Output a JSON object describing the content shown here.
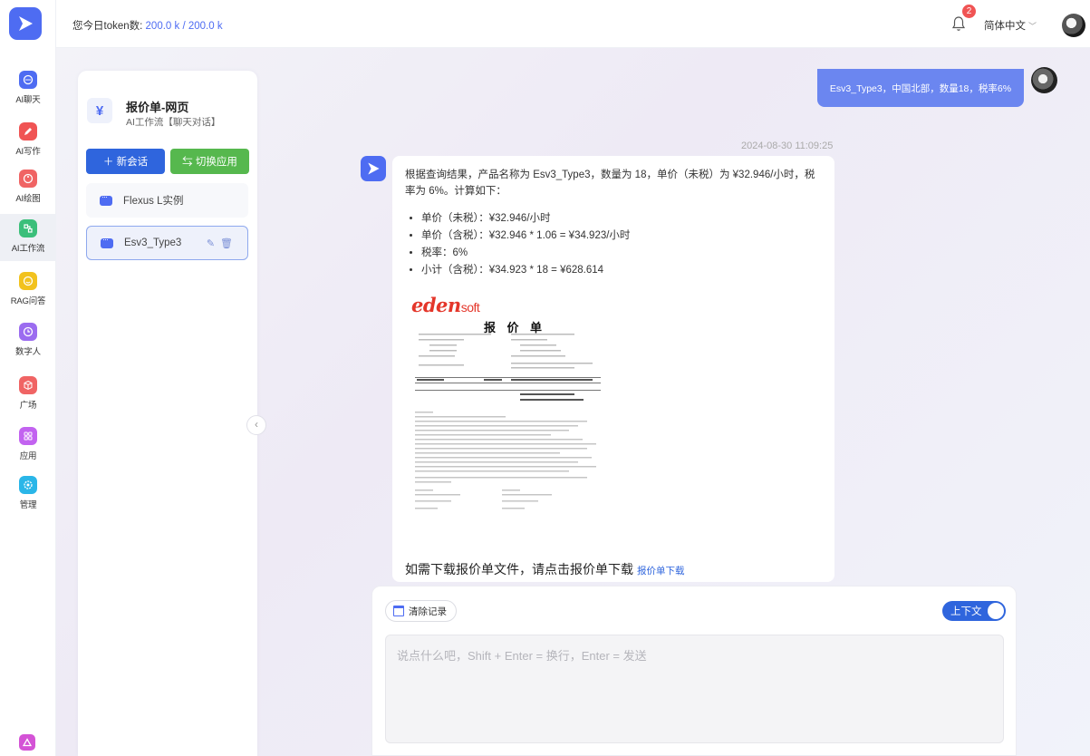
{
  "nav": {
    "items": [
      {
        "label": "AI聊天",
        "icon": "chat-bubble-icon",
        "color": "#4e6cf2"
      },
      {
        "label": "AI写作",
        "icon": "pen-icon",
        "color": "#f05454"
      },
      {
        "label": "AI绘图",
        "icon": "palette-icon",
        "color": "#f06464"
      },
      {
        "label": "AI工作流",
        "icon": "workflow-icon",
        "color": "#3bbf7a",
        "active": true
      },
      {
        "label": "RAG问答",
        "icon": "qa-icon",
        "color": "#f2c21e"
      },
      {
        "label": "数字人",
        "icon": "digital-human-icon",
        "color": "#9b6cf0"
      },
      {
        "label": "广场",
        "icon": "cube-icon",
        "color": "#f06464"
      },
      {
        "label": "应用",
        "icon": "apps-icon",
        "color": "#c263f0"
      },
      {
        "label": "管理",
        "icon": "settings-icon",
        "color": "#2ab6e8"
      }
    ]
  },
  "header": {
    "token_label": "您今日token数: ",
    "token_value": "200.0 k / 200.0 k",
    "notification_count": "2",
    "language": "简体中文"
  },
  "panel": {
    "app_title": "报价单-网页",
    "app_subtitle": "AI工作流【聊天对话】",
    "new_chat_label": "＋ 新会话",
    "switch_app_label": "⇆ 切换应用",
    "sessions": [
      {
        "label": "Flexus L实例"
      },
      {
        "label": "Esv3_Type3"
      }
    ]
  },
  "chat": {
    "user_message": "Esv3_Type3，中国北部，数量18，税率6%",
    "timestamp": "2024-08-30 11:09:25",
    "bot_intro": "根据查询结果，产品名称为 Esv3_Type3，数量为 18，单价（未税）为 ¥32.946/小时，税率为 6%。计算如下：",
    "bot_items": [
      "单价（未税）：¥32.946/小时",
      "单价（含税）：¥32.946 * 1.06 = ¥34.923/小时",
      "税率：6%",
      "小计（含税）：¥34.923 * 18 = ¥628.614"
    ],
    "quote_logo": "eden",
    "quote_logo_suffix": "soft",
    "quote_title": "报 价 单",
    "download_text": "如需下载报价单文件，请点击报价单下载",
    "download_link": "报价单下载"
  },
  "input": {
    "clear_label": "清除记录",
    "context_label": "上下文",
    "context_on": true,
    "placeholder": "说点什么吧，Shift + Enter = 换行，Enter = 发送"
  }
}
